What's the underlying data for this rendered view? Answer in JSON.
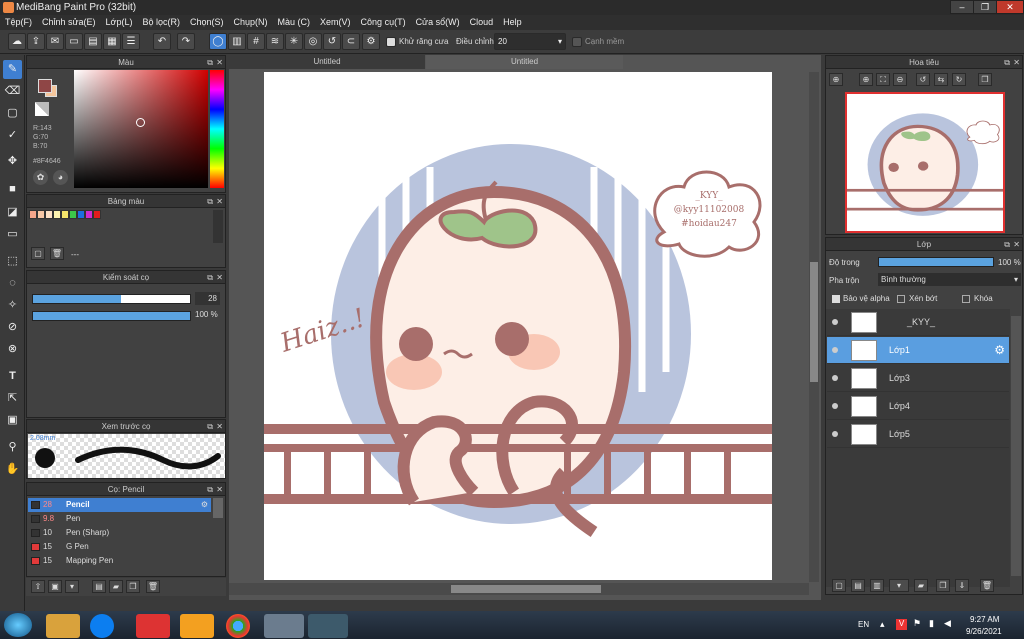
{
  "window": {
    "title": "MediBang Paint Pro (32bit)"
  },
  "menu": [
    "Tệp(F)",
    "Chỉnh sửa(E)",
    "Lớp(L)",
    "Bộ lọc(R)",
    "Chọn(S)",
    "Chụp(N)",
    "Màu (C)",
    "Xem(V)",
    "Công cụ(T)",
    "Cửa sổ(W)",
    "Cloud",
    "Help"
  ],
  "toolbar": {
    "antialias_label": "Khử răng cưa",
    "adjust_label": "Điều chỉnh",
    "adjust_value": "20",
    "smooth_label": "Cạnh mềm"
  },
  "color_panel": {
    "title": "Màu",
    "r": "R:143",
    "g": "G:70",
    "b": "B:70",
    "hex": "#8F4646",
    "fg": "#8F4646",
    "bg": "#f4c59b"
  },
  "palette_panel": {
    "title": "Bảng màu",
    "placeholder": "---"
  },
  "brush_control": {
    "title": "Kiểm soát cọ",
    "size": "28",
    "opacity": "100 %"
  },
  "brush_preview": {
    "title": "Xem trước cọ",
    "size_label": "2.08mm"
  },
  "brushes": {
    "title": "Cọ: Pencil",
    "items": [
      {
        "size": "28",
        "name": "Pencil",
        "color": "#333333"
      },
      {
        "size": "9.8",
        "name": "Pen",
        "color": "#333333"
      },
      {
        "size": "10",
        "name": "Pen (Sharp)",
        "color": "#333333"
      },
      {
        "size": "15",
        "name": "G Pen",
        "color": "#e23a3a"
      },
      {
        "size": "15",
        "name": "Mapping Pen",
        "color": "#e23a3a"
      }
    ]
  },
  "tabs": [
    "Untitled",
    "Untitled"
  ],
  "navigator": {
    "title": "Hoa tiêu"
  },
  "layers": {
    "title": "Lớp",
    "opacity_label": "Độ trong",
    "opacity_value": "100 %",
    "blend_label": "Pha trộn",
    "blend_value": "Bình thường",
    "protect_alpha": "Bảo vệ alpha",
    "clipping": "Xén bớt",
    "lock": "Khóa",
    "items": [
      {
        "name": "_KYY_"
      },
      {
        "name": "Lớp1"
      },
      {
        "name": "Lớp3"
      },
      {
        "name": "Lớp4"
      },
      {
        "name": "Lớp5"
      }
    ]
  },
  "artwork": {
    "signature_lines": [
      "_KYY_",
      "@kyy11102008",
      "#hoidau247"
    ],
    "doodle": "Haiz..!"
  },
  "taskbar": {
    "lang": "EN",
    "time": "9:27 AM",
    "date": "9/26/2021"
  },
  "colors": {
    "accent": "#3f7fd1",
    "line": "#a86e6b"
  }
}
